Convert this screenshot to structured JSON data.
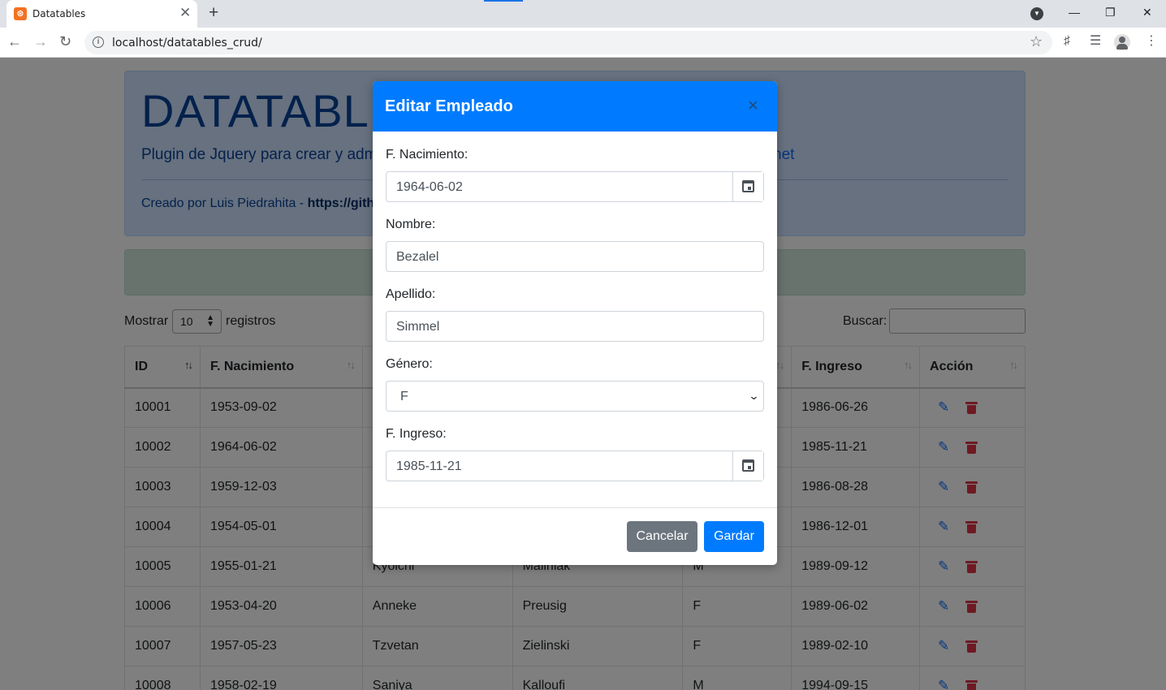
{
  "browser": {
    "tab_title": "Datatables",
    "url": "localhost/datatables_crud/"
  },
  "page": {
    "jumbotron_title": "DATATABLES",
    "jumbotron_subtitle": "Plugin de Jquery para crear y adm",
    "jumbotron_link_fragment": "net",
    "credit_prefix": "Creado por Luis Piedrahita - ",
    "credit_link": "https://gith"
  },
  "datatable": {
    "show_label": "Mostrar",
    "length_value": "10",
    "records_label": "registros",
    "search_label": "Buscar:",
    "columns": [
      "ID",
      "F. Nacimiento",
      "",
      "",
      "",
      "F. Ingreso",
      "Acción"
    ],
    "rows": [
      [
        "10001",
        "1953-09-02",
        "",
        "",
        "",
        "1986-06-26"
      ],
      [
        "10002",
        "1964-06-02",
        "",
        "",
        "",
        "1985-11-21"
      ],
      [
        "10003",
        "1959-12-03",
        "",
        "",
        "",
        "1986-08-28"
      ],
      [
        "10004",
        "1954-05-01",
        "",
        "",
        "",
        "1986-12-01"
      ],
      [
        "10005",
        "1955-01-21",
        "Kyoichi",
        "Maliniak",
        "M",
        "1989-09-12"
      ],
      [
        "10006",
        "1953-04-20",
        "Anneke",
        "Preusig",
        "F",
        "1989-06-02"
      ],
      [
        "10007",
        "1957-05-23",
        "Tzvetan",
        "Zielinski",
        "F",
        "1989-02-10"
      ],
      [
        "10008",
        "1958-02-19",
        "Saniya",
        "Kalloufi",
        "M",
        "1994-09-15"
      ]
    ]
  },
  "modal": {
    "title": "Editar Empleado",
    "close_glyph": "×",
    "fields": {
      "birth_label": "F. Nacimiento:",
      "birth_value": "1964-06-02",
      "name_label": "Nombre:",
      "name_value": "Bezalel",
      "lastname_label": "Apellido:",
      "lastname_value": "Simmel",
      "gender_label": "Género:",
      "gender_value": "F",
      "hire_label": "F. Ingreso:",
      "hire_value": "1985-11-21"
    },
    "cancel_label": "Cancelar",
    "save_label": "Gardar"
  },
  "colors": {
    "modal_header": "#007bff",
    "danger": "#dc3545",
    "secondary": "#6c757d"
  }
}
